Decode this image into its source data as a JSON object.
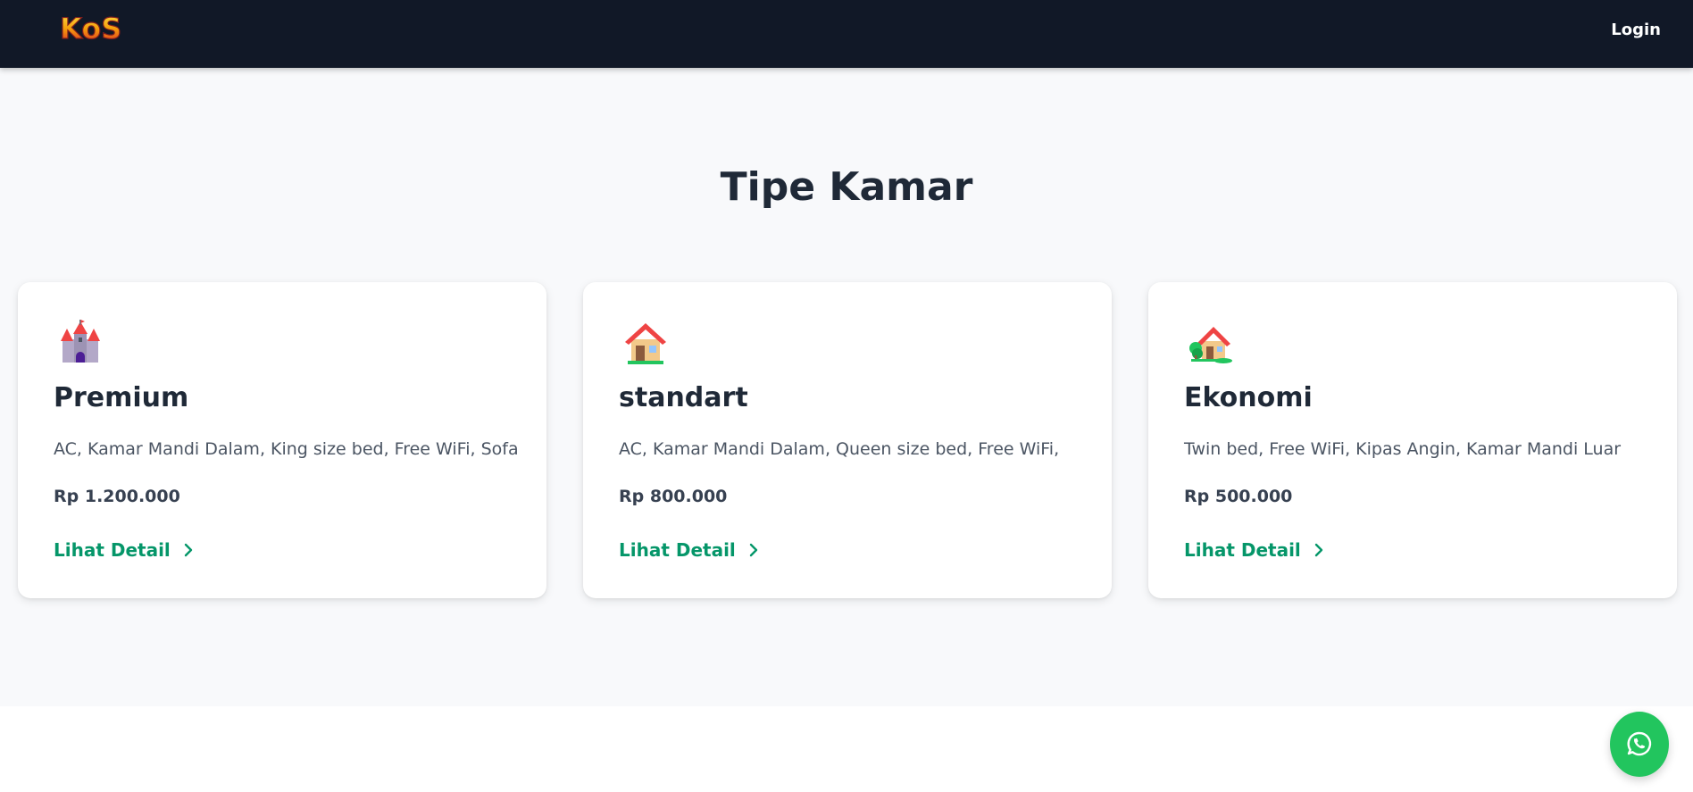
{
  "navbar": {
    "logo_text": "KoS",
    "login_label": "Login"
  },
  "section": {
    "heading": "Tipe Kamar"
  },
  "cards": [
    {
      "icon": "castle-icon",
      "title": "Premium",
      "description": "AC, Kamar Mandi Dalam, King size bed, Free WiFi, Sofa",
      "price": "Rp 1.200.000",
      "link_label": "Lihat Detail"
    },
    {
      "icon": "house-icon",
      "title": "standart",
      "description": "AC, Kamar Mandi Dalam, Queen size bed, Free WiFi,",
      "price": "Rp 800.000",
      "link_label": "Lihat Detail"
    },
    {
      "icon": "house-with-garden-icon",
      "title": "Ekonomi",
      "description": "Twin bed, Free WiFi, Kipas Angin, Kamar Mandi Luar",
      "price": "Rp 500.000",
      "link_label": "Lihat Detail"
    }
  ],
  "floating": {
    "icon": "whatsapp-icon"
  },
  "colors": {
    "navbar_bg": "#111827",
    "section_bg": "#f8f9fb",
    "link_green": "#059669",
    "whatsapp_green": "#22c55e"
  }
}
